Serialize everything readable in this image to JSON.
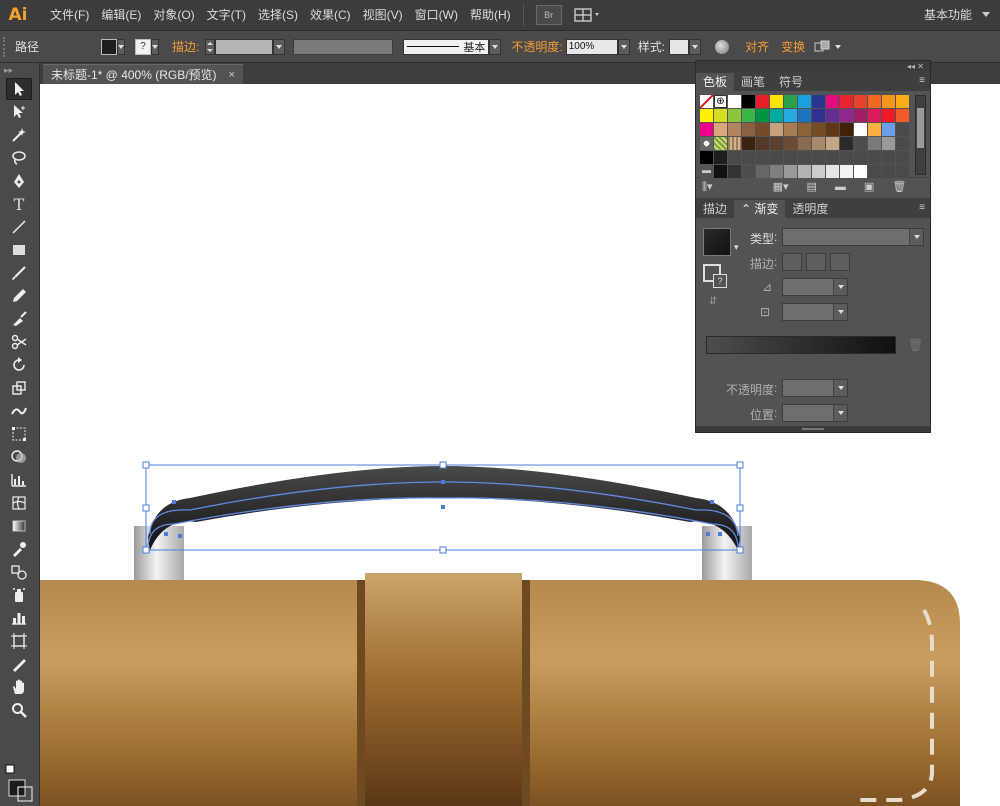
{
  "app": {
    "logo": "Ai"
  },
  "menu": {
    "items": [
      "文件(F)",
      "编辑(E)",
      "对象(O)",
      "文字(T)",
      "选择(S)",
      "效果(C)",
      "视图(V)",
      "窗口(W)",
      "帮助(H)"
    ],
    "bridge": "Br",
    "workspace": "基本功能"
  },
  "control": {
    "object_type": "路径",
    "stroke_label": "描边",
    "brush_style": "基本",
    "opacity_label": "不透明度",
    "opacity_value": "100%",
    "style_label": "样式",
    "align_label": "对齐",
    "transform_label": "变换"
  },
  "document": {
    "tab_title": "未标题-1* @ 400% (RGB/预览)",
    "close": "×"
  },
  "panels": {
    "swatch_tabs": [
      "色板",
      "画笔",
      "符号"
    ],
    "gradient_tabs": [
      "描边",
      "渐变",
      "透明度"
    ],
    "gradient": {
      "type_label": "类型",
      "stroke_label": "描边",
      "opacity_label": "不透明度",
      "location_label": "位置"
    }
  },
  "colors": {
    "accent": "#f39c36",
    "ui_dark": "#3c3c3c",
    "panel": "#535353"
  },
  "icons": [
    "selection-icon",
    "direct-selection-icon",
    "magic-wand-icon",
    "lasso-icon",
    "pen-icon",
    "type-icon",
    "line-icon",
    "rectangle-icon",
    "paintbrush-icon",
    "pencil-icon",
    "blob-brush-icon",
    "scissors-icon",
    "rotate-icon",
    "scale-icon",
    "warp-icon",
    "free-transform-icon",
    "shape-builder-icon",
    "graph-icon",
    "mesh-icon",
    "gradient-icon",
    "eyedropper-icon",
    "blend-icon",
    "symbol-sprayer-icon",
    "column-graph-icon",
    "artboard-icon",
    "slice-icon",
    "hand-icon",
    "zoom-icon"
  ]
}
